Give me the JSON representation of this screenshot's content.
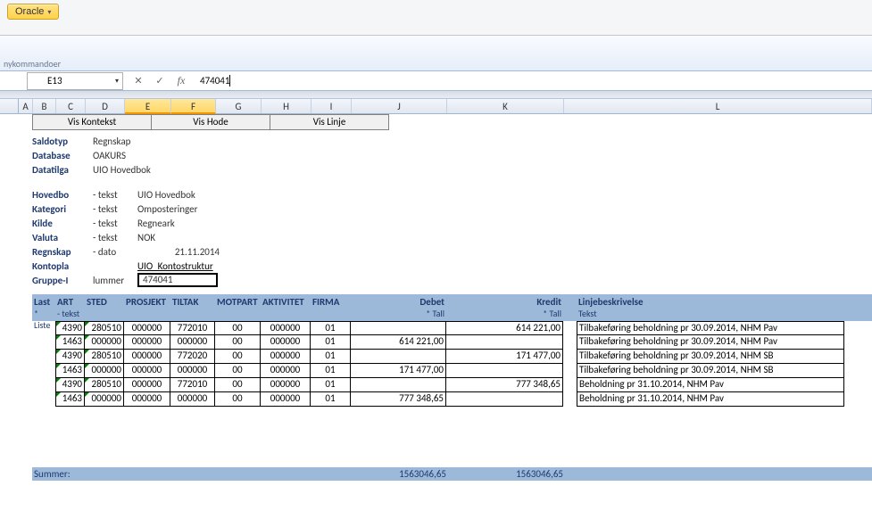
{
  "ribbon": {
    "oracle": "Oracle"
  },
  "lower_label": "nykommandoer",
  "formula": {
    "name_box": "E13",
    "value": "474041"
  },
  "col_headers": [
    "A",
    "B",
    "C",
    "D",
    "E",
    "F",
    "G",
    "H",
    "I",
    "J",
    "K",
    "L"
  ],
  "buttons": {
    "kontekst": "Vis Kontekst",
    "hode": "Vis Hode",
    "linje": "Vis Linje"
  },
  "meta": {
    "saldotyp_lbl": "Saldotyp",
    "saldotyp_val": "Regnskap",
    "database_lbl": "Database",
    "database_val": "OAKURS",
    "datatilga_lbl": "Datatilga",
    "datatilga_val": "UIO Hovedbok",
    "hovedbo_lbl": "Hovedbo",
    "hovedbo_sub": "- tekst",
    "hovedbo_val": "UIO Hovedbok",
    "kategori_lbl": "Kategori",
    "kategori_sub": "- tekst",
    "kategori_val": "Omposteringer",
    "kilde_lbl": "Kilde",
    "kilde_sub": "- tekst",
    "kilde_val": "Regneark",
    "valuta_lbl": "Valuta",
    "valuta_sub": "- tekst",
    "valuta_val": "NOK",
    "regnskap_lbl": "Regnskap",
    "regnskap_sub": "- dato",
    "regnskap_val": "21.11.2014",
    "kontopla_lbl": "Kontopla",
    "kontopla_val": "UIO_Kontostruktur",
    "gruppe_lbl": "Gruppe-I",
    "gruppe_sub": "lummer",
    "gruppe_val": "474041"
  },
  "headers": {
    "last": "Last",
    "last_sub": "* Liste",
    "art": "ART",
    "art_sub": "- tekst",
    "sted": "STED",
    "prosj": "PROSJEKT",
    "tiltak": "TILTAK",
    "motpart": "MOTPART",
    "aktivitet": "AKTIVITET",
    "firma": "FIRMA",
    "debet": "Debet",
    "debet_sub": "* Tall",
    "kredit": "Kredit",
    "kredit_sub": "* Tall",
    "linje": "Linjebeskrivelse",
    "linje_sub": "Tekst"
  },
  "rows": [
    {
      "art": "4390",
      "sted": "280510",
      "prosj": "000000",
      "tiltak": "772010",
      "mot": "00",
      "akt": "000000",
      "firma": "01",
      "debet": "",
      "kredit": "614 221,00",
      "linje": "Tilbakeføring beholdning pr 30.09.2014, NHM Pav"
    },
    {
      "art": "1463",
      "sted": "000000",
      "prosj": "000000",
      "tiltak": "000000",
      "mot": "00",
      "akt": "000000",
      "firma": "01",
      "debet": "614 221,00",
      "kredit": "",
      "linje": "Tilbakeføring beholdning pr 30.09.2014, NHM Pav"
    },
    {
      "art": "4390",
      "sted": "280510",
      "prosj": "000000",
      "tiltak": "772020",
      "mot": "00",
      "akt": "000000",
      "firma": "01",
      "debet": "",
      "kredit": "171 477,00",
      "linje": "Tilbakeføring beholdning pr 30.09.2014, NHM SB"
    },
    {
      "art": "1463",
      "sted": "000000",
      "prosj": "000000",
      "tiltak": "000000",
      "mot": "00",
      "akt": "000000",
      "firma": "01",
      "debet": "171 477,00",
      "kredit": "",
      "linje": "Tilbakeføring beholdning pr 30.09.2014, NHM SB"
    },
    {
      "art": "4390",
      "sted": "280510",
      "prosj": "000000",
      "tiltak": "772010",
      "mot": "00",
      "akt": "000000",
      "firma": "01",
      "debet": "",
      "kredit": "777 348,65",
      "linje": "Beholdning pr 31.10.2014, NHM Pav"
    },
    {
      "art": "1463",
      "sted": "000000",
      "prosj": "000000",
      "tiltak": "000000",
      "mot": "00",
      "akt": "000000",
      "firma": "01",
      "debet": "777 348,65",
      "kredit": "",
      "linje": "Beholdning pr 31.10.2014, NHM Pav"
    }
  ],
  "summer": {
    "label": "Summer:",
    "debet": "1563046,65",
    "kredit": "1563046,65"
  }
}
